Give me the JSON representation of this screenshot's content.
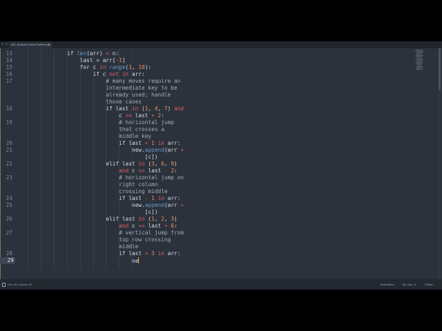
{
  "tab": {
    "title": "351. Android Unlock Patterns.py",
    "close": "×",
    "nav": "◂ ▸"
  },
  "status": {
    "position": "Line 29, Column 35",
    "indent": "Indentation",
    "tab_size": "Tab Size: 4",
    "language": "Python"
  },
  "code": [
    {
      "num": "13",
      "indent": 0,
      "tokens": [
        [
          "if ",
          ""
        ],
        [
          "len",
          "bi"
        ],
        [
          "(arr) ",
          ""
        ],
        [
          "<",
          "op"
        ],
        [
          " n:",
          ""
        ]
      ]
    },
    {
      "num": "14",
      "indent": 4,
      "tokens": [
        [
          "last = arr[",
          ""
        ],
        [
          "-",
          "op"
        ],
        [
          "1",
          "num"
        ],
        [
          "]",
          ""
        ]
      ]
    },
    {
      "num": "15",
      "indent": 4,
      "tokens": [
        [
          "for c ",
          ""
        ],
        [
          "in",
          "kw"
        ],
        [
          " ",
          ""
        ],
        [
          "range",
          "bi"
        ],
        [
          "(",
          ""
        ],
        [
          "1",
          "num"
        ],
        [
          ", ",
          ""
        ],
        [
          "10",
          "num"
        ],
        [
          "):",
          ""
        ]
      ]
    },
    {
      "num": "16",
      "indent": 8,
      "tokens": [
        [
          "if c ",
          ""
        ],
        [
          "not in",
          "kw"
        ],
        [
          " arr:",
          ""
        ]
      ]
    },
    {
      "num": "17",
      "indent": 12,
      "tokens": [
        [
          "# many moves require an",
          "cm"
        ]
      ]
    },
    {
      "num": "",
      "indent": 12,
      "tokens": [
        [
          "intermediate key to be",
          "cm"
        ]
      ]
    },
    {
      "num": "",
      "indent": 12,
      "tokens": [
        [
          "already used; handle",
          "cm"
        ]
      ]
    },
    {
      "num": "",
      "indent": 12,
      "tokens": [
        [
          "those cases",
          "cm"
        ]
      ]
    },
    {
      "num": "18",
      "indent": 12,
      "tokens": [
        [
          "if last ",
          ""
        ],
        [
          "in",
          "kw"
        ],
        [
          " (",
          ""
        ],
        [
          "1",
          "num"
        ],
        [
          ", ",
          ""
        ],
        [
          "4",
          "num"
        ],
        [
          ", ",
          ""
        ],
        [
          "7",
          "num"
        ],
        [
          ") ",
          ""
        ],
        [
          "and",
          "kw"
        ]
      ]
    },
    {
      "num": "",
      "indent": 16,
      "tokens": [
        [
          "c ",
          ""
        ],
        [
          "==",
          "op"
        ],
        [
          " last ",
          ""
        ],
        [
          "+",
          "op"
        ],
        [
          " ",
          ""
        ],
        [
          "2",
          "num"
        ],
        [
          ":",
          ""
        ]
      ]
    },
    {
      "num": "19",
      "indent": 16,
      "tokens": [
        [
          "# horizontal jump",
          "cm"
        ]
      ]
    },
    {
      "num": "",
      "indent": 16,
      "tokens": [
        [
          "that crosses a",
          "cm"
        ]
      ]
    },
    {
      "num": "",
      "indent": 16,
      "tokens": [
        [
          "middle key",
          "cm"
        ]
      ]
    },
    {
      "num": "20",
      "indent": 16,
      "tokens": [
        [
          "if last ",
          ""
        ],
        [
          "+",
          "op"
        ],
        [
          " ",
          ""
        ],
        [
          "1",
          "num"
        ],
        [
          " ",
          ""
        ],
        [
          "in",
          "kw"
        ],
        [
          " arr:",
          ""
        ]
      ]
    },
    {
      "num": "21",
      "indent": 20,
      "tokens": [
        [
          "new.",
          ""
        ],
        [
          "append",
          "fn"
        ],
        [
          "(arr ",
          ""
        ],
        [
          "+",
          "op"
        ]
      ]
    },
    {
      "num": "",
      "indent": 24,
      "tokens": [
        [
          "[c])",
          ""
        ]
      ]
    },
    {
      "num": "22",
      "indent": 12,
      "tokens": [
        [
          "elif last ",
          ""
        ],
        [
          "in",
          "kw"
        ],
        [
          " (",
          ""
        ],
        [
          "3",
          "num"
        ],
        [
          ", ",
          ""
        ],
        [
          "6",
          "num"
        ],
        [
          ", ",
          ""
        ],
        [
          "9",
          "num"
        ],
        [
          ")",
          ""
        ]
      ]
    },
    {
      "num": "",
      "indent": 16,
      "tokens": [
        [
          "and",
          "kw"
        ],
        [
          " c ",
          ""
        ],
        [
          "==",
          "op"
        ],
        [
          " last ",
          ""
        ],
        [
          "-",
          "op"
        ],
        [
          " ",
          ""
        ],
        [
          "2",
          "num"
        ],
        [
          ":",
          ""
        ]
      ]
    },
    {
      "num": "23",
      "indent": 16,
      "tokens": [
        [
          "# horizontal jump on",
          "cm"
        ]
      ]
    },
    {
      "num": "",
      "indent": 16,
      "tokens": [
        [
          "right column",
          "cm"
        ]
      ]
    },
    {
      "num": "",
      "indent": 16,
      "tokens": [
        [
          "crossing middle",
          "cm"
        ]
      ]
    },
    {
      "num": "24",
      "indent": 16,
      "tokens": [
        [
          "if last ",
          ""
        ],
        [
          "-",
          "op"
        ],
        [
          " ",
          ""
        ],
        [
          "1",
          "num"
        ],
        [
          " ",
          ""
        ],
        [
          "in",
          "kw"
        ],
        [
          " arr:",
          ""
        ]
      ]
    },
    {
      "num": "25",
      "indent": 20,
      "tokens": [
        [
          "new.",
          ""
        ],
        [
          "append",
          "fn"
        ],
        [
          "(arr ",
          ""
        ],
        [
          "+",
          "op"
        ]
      ]
    },
    {
      "num": "",
      "indent": 24,
      "tokens": [
        [
          "[c])",
          ""
        ]
      ]
    },
    {
      "num": "26",
      "indent": 12,
      "tokens": [
        [
          "elif last ",
          ""
        ],
        [
          "in",
          "kw"
        ],
        [
          " (",
          ""
        ],
        [
          "1",
          "num"
        ],
        [
          ", ",
          ""
        ],
        [
          "2",
          "num"
        ],
        [
          ", ",
          ""
        ],
        [
          "3",
          "num"
        ],
        [
          ")",
          ""
        ]
      ]
    },
    {
      "num": "",
      "indent": 16,
      "tokens": [
        [
          "and",
          "kw"
        ],
        [
          " c ",
          ""
        ],
        [
          "==",
          "op"
        ],
        [
          " last ",
          ""
        ],
        [
          "+",
          "op"
        ],
        [
          " ",
          ""
        ],
        [
          "6",
          "num"
        ],
        [
          ":",
          ""
        ]
      ]
    },
    {
      "num": "27",
      "indent": 16,
      "tokens": [
        [
          "# vertical jump from",
          "cm"
        ]
      ]
    },
    {
      "num": "",
      "indent": 16,
      "tokens": [
        [
          "top row crossing",
          "cm"
        ]
      ]
    },
    {
      "num": "",
      "indent": 16,
      "tokens": [
        [
          "middle",
          "cm"
        ]
      ]
    },
    {
      "num": "28",
      "indent": 16,
      "tokens": [
        [
          "if last ",
          ""
        ],
        [
          "+",
          "op"
        ],
        [
          " ",
          ""
        ],
        [
          "3",
          "num"
        ],
        [
          " ",
          ""
        ],
        [
          "in",
          "kw"
        ],
        [
          " arr:",
          ""
        ]
      ]
    },
    {
      "num": "29",
      "indent": 20,
      "current": true,
      "tokens": [
        [
          "ne",
          ""
        ]
      ]
    }
  ]
}
